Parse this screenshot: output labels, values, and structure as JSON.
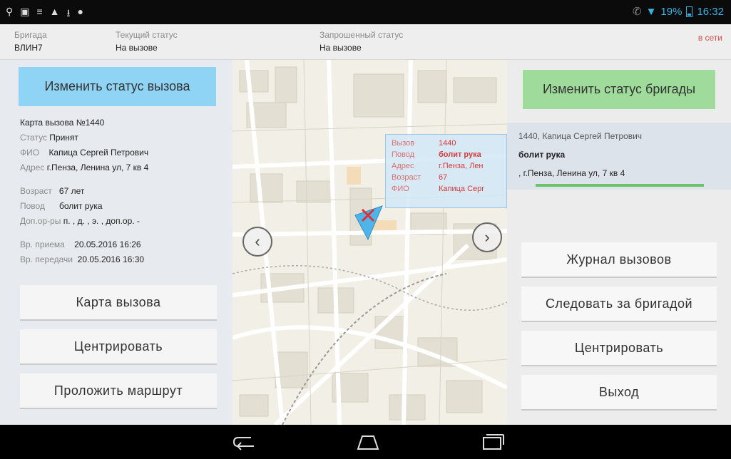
{
  "statusbar": {
    "left_icons": [
      "usb-icon",
      "image-icon",
      "bars-icon",
      "warning-icon",
      "download-icon",
      "chat-icon"
    ],
    "battery": "19%",
    "time": "16:32"
  },
  "header": {
    "brigade_label": "Бригада",
    "brigade_value": "ВЛИН7",
    "current_status_label": "Текущий статус",
    "current_status_value": "На вызове",
    "requested_status_label": "Запрошенный статус",
    "requested_status_value": "На вызове",
    "online": "в сети"
  },
  "left": {
    "change_call_status": "Изменить статус вызова",
    "card_title": "Карта вызова №1440",
    "status_label": "Статус",
    "status_value": "Принят",
    "fio_label": "ФИО",
    "fio_value": "Капица Сергей Петрович",
    "address_label": "Адрес",
    "address_value": "г.Пенза, Ленина ул, 7 кв 4",
    "age_label": "Возраст",
    "age_value": "67 лет",
    "reason_label": "Повод",
    "reason_value": "болит рука",
    "extra_label": "Доп.ор-ры",
    "extra_value": "п. , д. , э. , доп.ор. -",
    "received_label": "Вр. приема",
    "received_value": "20.05.2016 16:26",
    "transfer_label": "Вр. передачи",
    "transfer_value": "20.05.2016 16:30",
    "btn_card": "Карта вызова",
    "btn_center": "Центрировать",
    "btn_route": "Проложить маршрут"
  },
  "map": {
    "popup": {
      "call_label": "Вызов",
      "call_value": "1440",
      "reason_label": "Повод",
      "reason_value": "болит рука",
      "address_label": "Адрес",
      "address_value": "г.Пенза, Лен",
      "age_label": "Возраст",
      "age_value": "67",
      "fio_label": "ФИО",
      "fio_value": "Капица Серг"
    },
    "prev_glyph": "‹",
    "next_glyph": "›"
  },
  "right": {
    "change_brigade_status": "Изменить статус бригады",
    "call_line1": "1440, Капица Сергей Петрович",
    "call_line2": "болит рука",
    "call_line3": ", г.Пенза, Ленина ул, 7 кв 4",
    "btn_log": "Журнал вызовов",
    "btn_follow": "Следовать за бригадой",
    "btn_center": "Центрировать",
    "btn_exit": "Выход"
  },
  "colors": {
    "call_status_button": "#8fd3f5",
    "brigade_status_button": "#9fdc9b",
    "online": "#e34c4c",
    "popup_text": "#d93a3a"
  }
}
